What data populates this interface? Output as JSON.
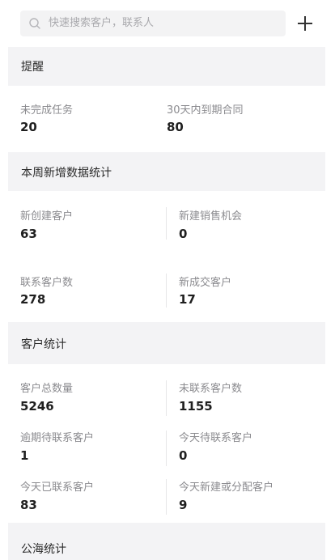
{
  "search": {
    "placeholder": "快速搜索客户，联系人"
  },
  "reminder": {
    "title": "提醒",
    "items": [
      {
        "label": "未完成任务",
        "value": "20"
      },
      {
        "label": "30天内到期合同",
        "value": "80"
      }
    ]
  },
  "weekly": {
    "title": "本周新增数据统计",
    "items": [
      {
        "label": "新创建客户",
        "value": "63"
      },
      {
        "label": "新建销售机会",
        "value": "0"
      },
      {
        "label": "联系客户数",
        "value": "278"
      },
      {
        "label": "新成交客户",
        "value": "17"
      }
    ]
  },
  "customers": {
    "title": "客户统计",
    "items": [
      {
        "label": "客户总数量",
        "value": "5246"
      },
      {
        "label": "未联系客户数",
        "value": "1155"
      },
      {
        "label": "逾期待联系客户",
        "value": "1"
      },
      {
        "label": "今天待联系客户",
        "value": "0"
      },
      {
        "label": "今天已联系客户",
        "value": "83"
      },
      {
        "label": "今天新建或分配客户",
        "value": "9"
      }
    ]
  },
  "pool": {
    "title": "公海统计"
  }
}
